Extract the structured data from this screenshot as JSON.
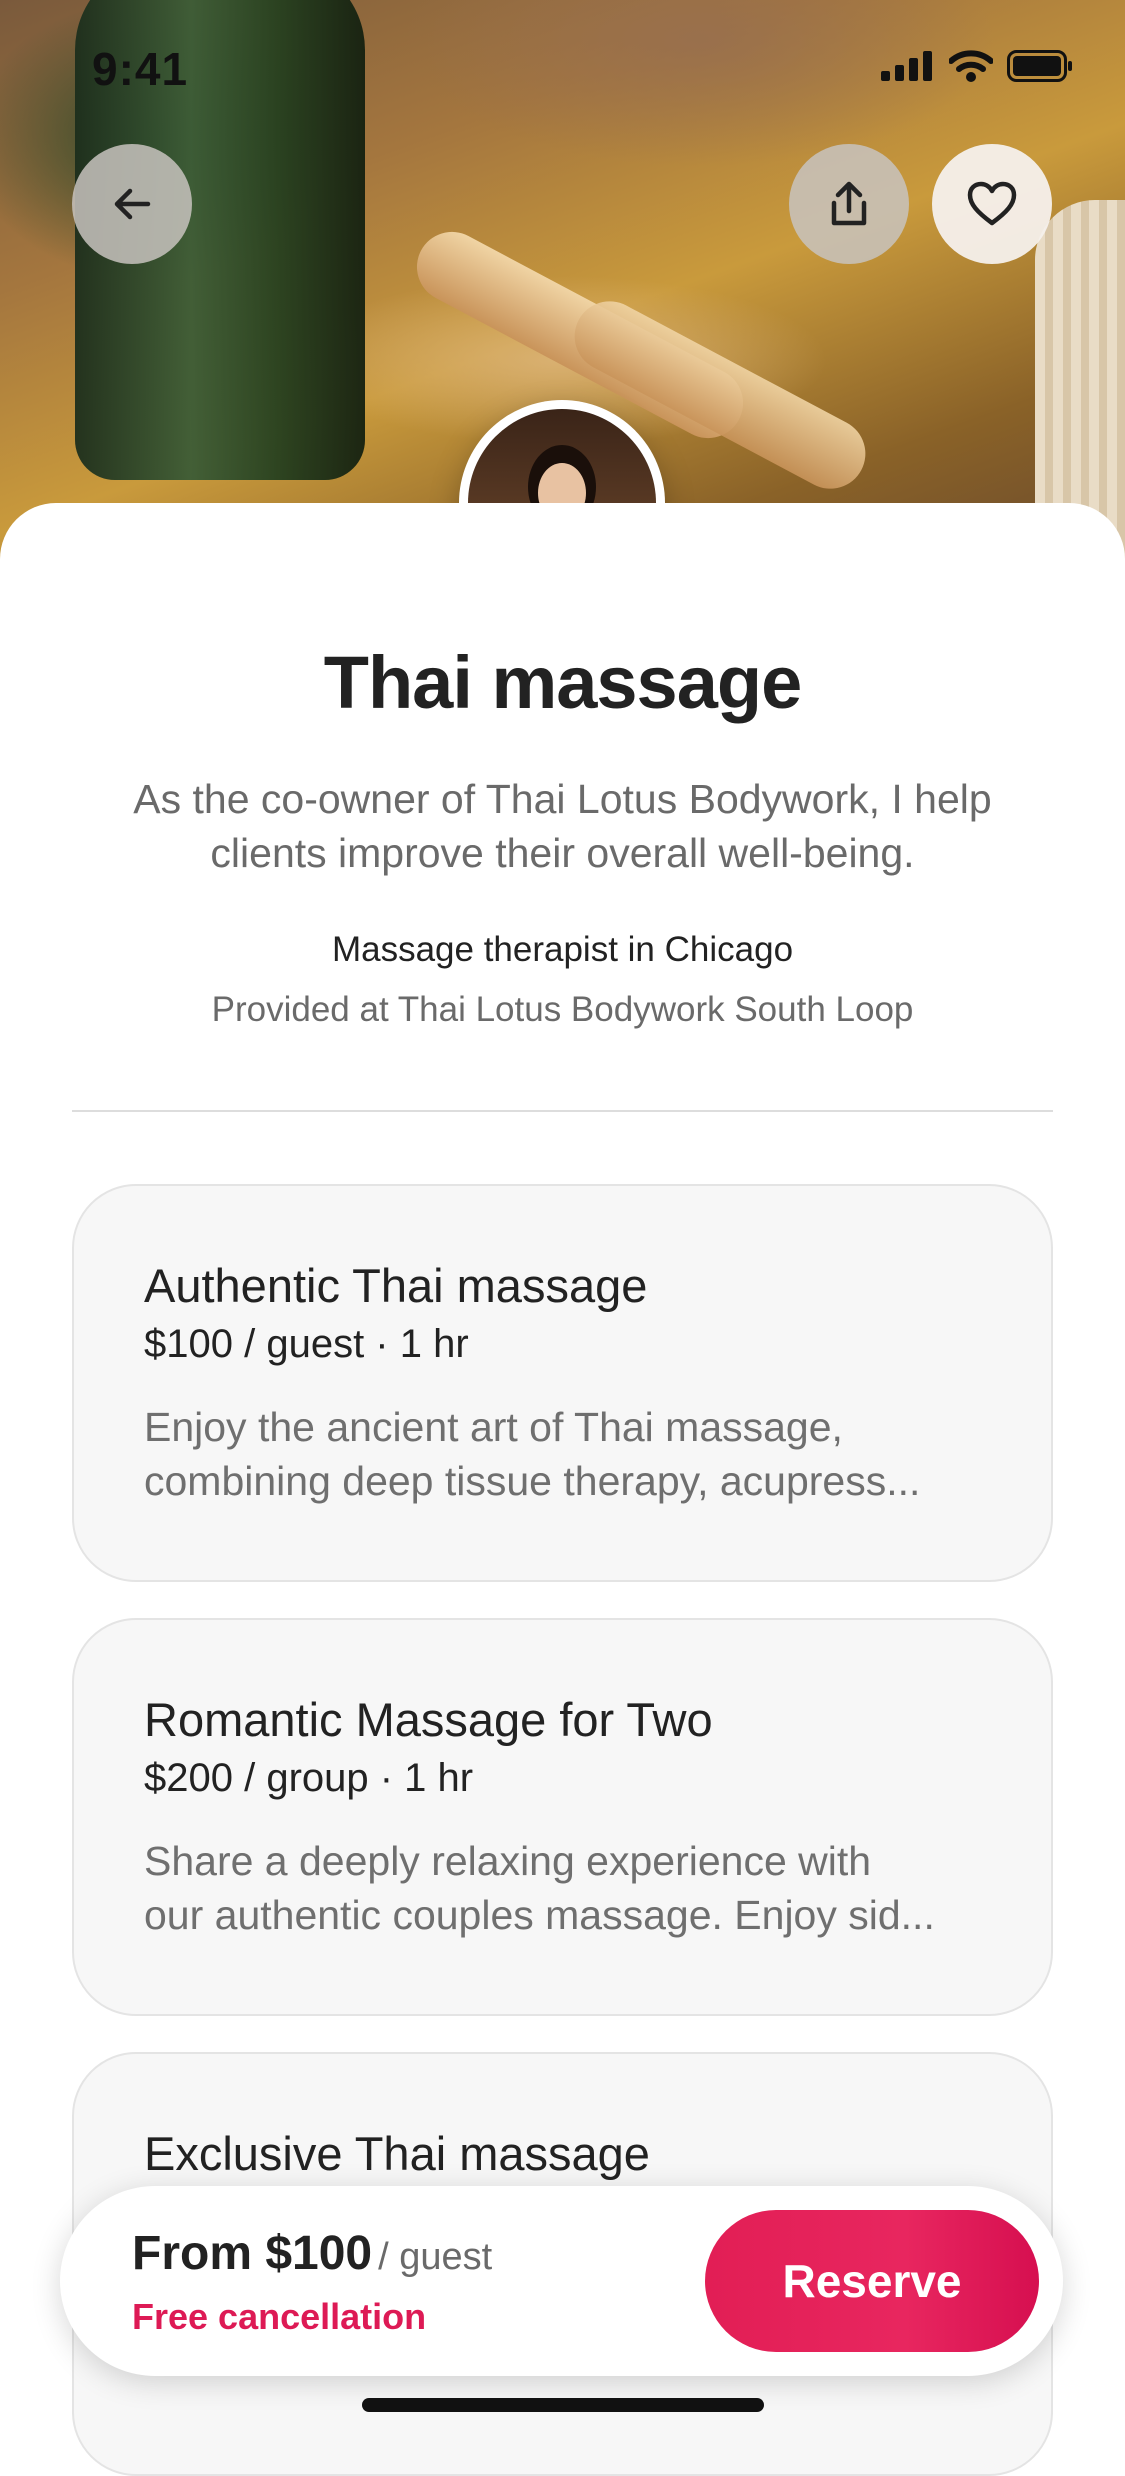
{
  "status_bar": {
    "time": "9:41",
    "icons": [
      "cellular-signal-icon",
      "wifi-icon",
      "battery-icon"
    ]
  },
  "hero": {
    "back_icon": "arrow-left-icon",
    "share_icon": "share-icon",
    "save_icon": "heart-icon"
  },
  "service": {
    "title": "Thai massage",
    "description": "As the co-owner of Thai Lotus Bodywork, I help clients improve their overall well-being.",
    "provider_role": "Massage therapist in Chicago",
    "location": "Provided at Thai Lotus Bodywork South Loop"
  },
  "offerings": [
    {
      "title": "Authentic Thai massage",
      "price": "$100 / guest · 1 hr",
      "description_line1": "Enjoy the ancient art of Thai massage,",
      "description_line2": "combining deep tissue therapy, acupress..."
    },
    {
      "title": "Romantic Massage for Two",
      "price": "$200 / group · 1 hr",
      "description_line1": "Share a deeply relaxing experience with",
      "description_line2": "our authentic couples massage. Enjoy sid..."
    },
    {
      "title": "Exclusive Thai massage",
      "price": "",
      "description_line1": "",
      "description_line2": ""
    }
  ],
  "booking_bar": {
    "price": "From $100",
    "unit": "/ guest",
    "cancellation": "Free cancellation",
    "reserve_label": "Reserve"
  },
  "colors": {
    "accent": "#E21E55",
    "text": "#222222",
    "muted": "#6A6A6A",
    "card_bg": "#F7F7F7"
  }
}
